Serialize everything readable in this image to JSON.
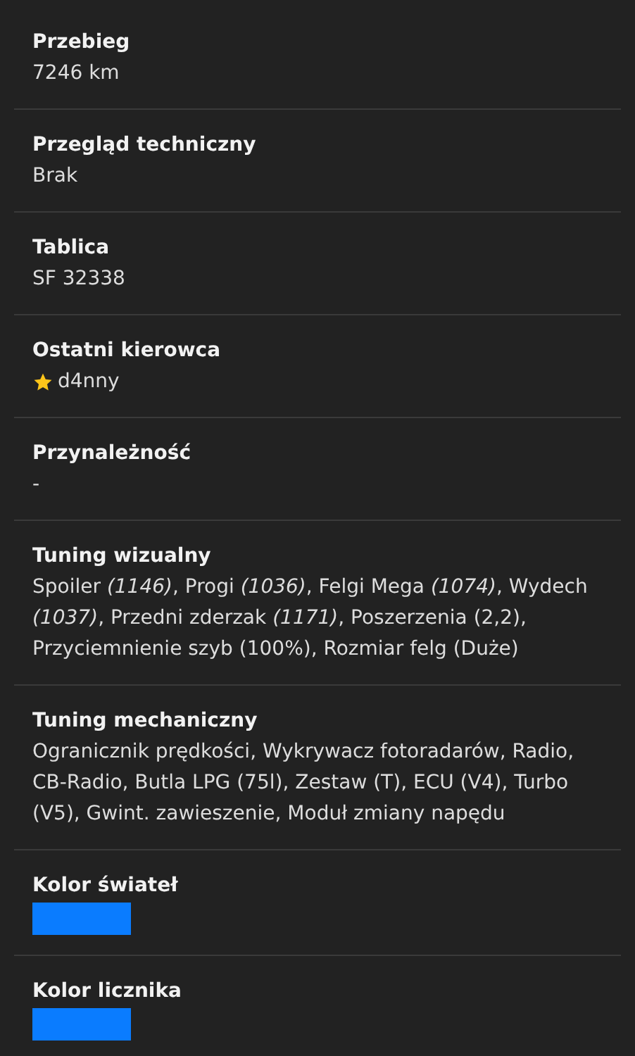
{
  "fields": [
    {
      "kind": "text",
      "label": "Przebieg",
      "value": "7246 km"
    },
    {
      "kind": "text",
      "label": "Przegląd techniczny",
      "value": "Brak"
    },
    {
      "kind": "text",
      "label": "Tablica",
      "value": "SF 32338"
    },
    {
      "kind": "driver",
      "label": "Ostatni kierowca",
      "value": "d4nny"
    },
    {
      "kind": "text",
      "label": "Przynależność",
      "value": "-"
    },
    {
      "kind": "text",
      "label": "Tuning wizualny",
      "value": "Spoiler *(1146)*, Progi *(1036)*, Felgi Mega *(1074)*, Wydech *(1037)*, Przedni zderzak *(1171)*, Poszerzenia (2,2), Przyciemnienie szyb (100%), Rozmiar felg (Duże)"
    },
    {
      "kind": "text",
      "label": "Tuning mechaniczny",
      "value": "Ogranicznik prędkości, Wykrywacz fotoradarów, Radio, CB-Radio, Butla LPG (75l), Zestaw (T), ECU (V4), Turbo (V5), Gwint. zawieszenie, Moduł zmiany napędu"
    },
    {
      "kind": "color",
      "label": "Kolor świateł",
      "color": "#0a7cff"
    },
    {
      "kind": "color",
      "label": "Kolor licznika",
      "color": "#0a7cff"
    }
  ]
}
